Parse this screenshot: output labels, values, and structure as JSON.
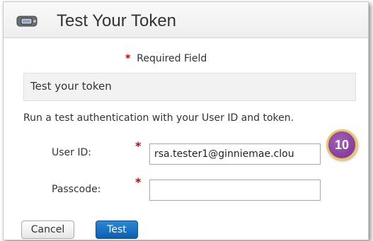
{
  "window": {
    "title": "Test Your Token",
    "icon": "token-icon"
  },
  "form": {
    "required_star": "*",
    "required_label": "Required Field",
    "section_title": "Test your token",
    "instructions": "Run a test authentication with your User ID and token.",
    "fields": [
      {
        "label": "User ID:",
        "value": "rsa.tester1@ginniemae.clou",
        "placeholder": "",
        "required": true
      },
      {
        "label": "Passcode:",
        "value": "",
        "placeholder": "",
        "required": true
      }
    ]
  },
  "annotation": {
    "step_number": "10",
    "badge_color": "#8a3ea6",
    "badge_border": "#e9c75a"
  },
  "buttons": {
    "cancel_label": "Cancel",
    "test_label": "Test"
  },
  "colors": {
    "required_star": "#cc0000",
    "primary_button": "#1a6fc4"
  }
}
